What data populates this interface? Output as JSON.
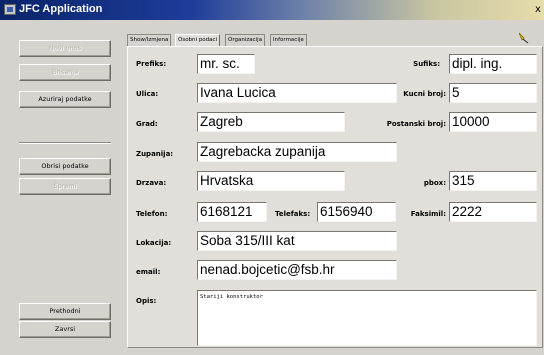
{
  "window": {
    "title": "JFC Application",
    "close_glyph": "x"
  },
  "left_buttons": {
    "b1": "Novi unos",
    "b2": "Brisanje",
    "b3": "Azuriraj podatke",
    "b4": "Obrisi podatke",
    "b5": "Spremi",
    "prethodni": "Prethodni",
    "zavrsi": "Zavrsi"
  },
  "tabs": [
    "Show/Izmjena",
    "Osobni podaci",
    "Organizacija",
    "Informacije"
  ],
  "labels": {
    "prefiks": "Prefiks:",
    "sufiks": "Sufiks:",
    "ulica": "Ulica:",
    "kucni_broj": "Kucni broj:",
    "grad": "Grad:",
    "postanski_broj": "Postanski broj:",
    "zupanija": "Zupanija:",
    "drzava": "Drzava:",
    "pbox": "pbox:",
    "telefon": "Telefon:",
    "telefaks": "Telefaks:",
    "faksimil": "Faksimil:",
    "lokacija": "Lokacija:",
    "email": "email:",
    "opis": "Opis:"
  },
  "values": {
    "prefiks": "mr. sc.",
    "sufiks": "dipl. ing.",
    "ulica": "Ivana Lucica",
    "kucni_broj": "5",
    "grad": "Zagreb",
    "postanski_broj": "10000",
    "zupanija": "Zagrebacka zupanija",
    "drzava": "Hrvatska",
    "pbox": "315",
    "telefon": "6168121",
    "telefaks": "6156940",
    "faksimil": "2222",
    "lokacija": "Soba 315/III kat",
    "email": "nenad.bojcetic@fsb.hr",
    "opis": "Stariji konstruktor"
  },
  "colors": {
    "title_bar": "#0a246a",
    "panel_bg": "#d6d3ce",
    "field_bg": "#ffffff"
  },
  "icons": {
    "app": "window-icon",
    "pin": "pin-icon"
  }
}
